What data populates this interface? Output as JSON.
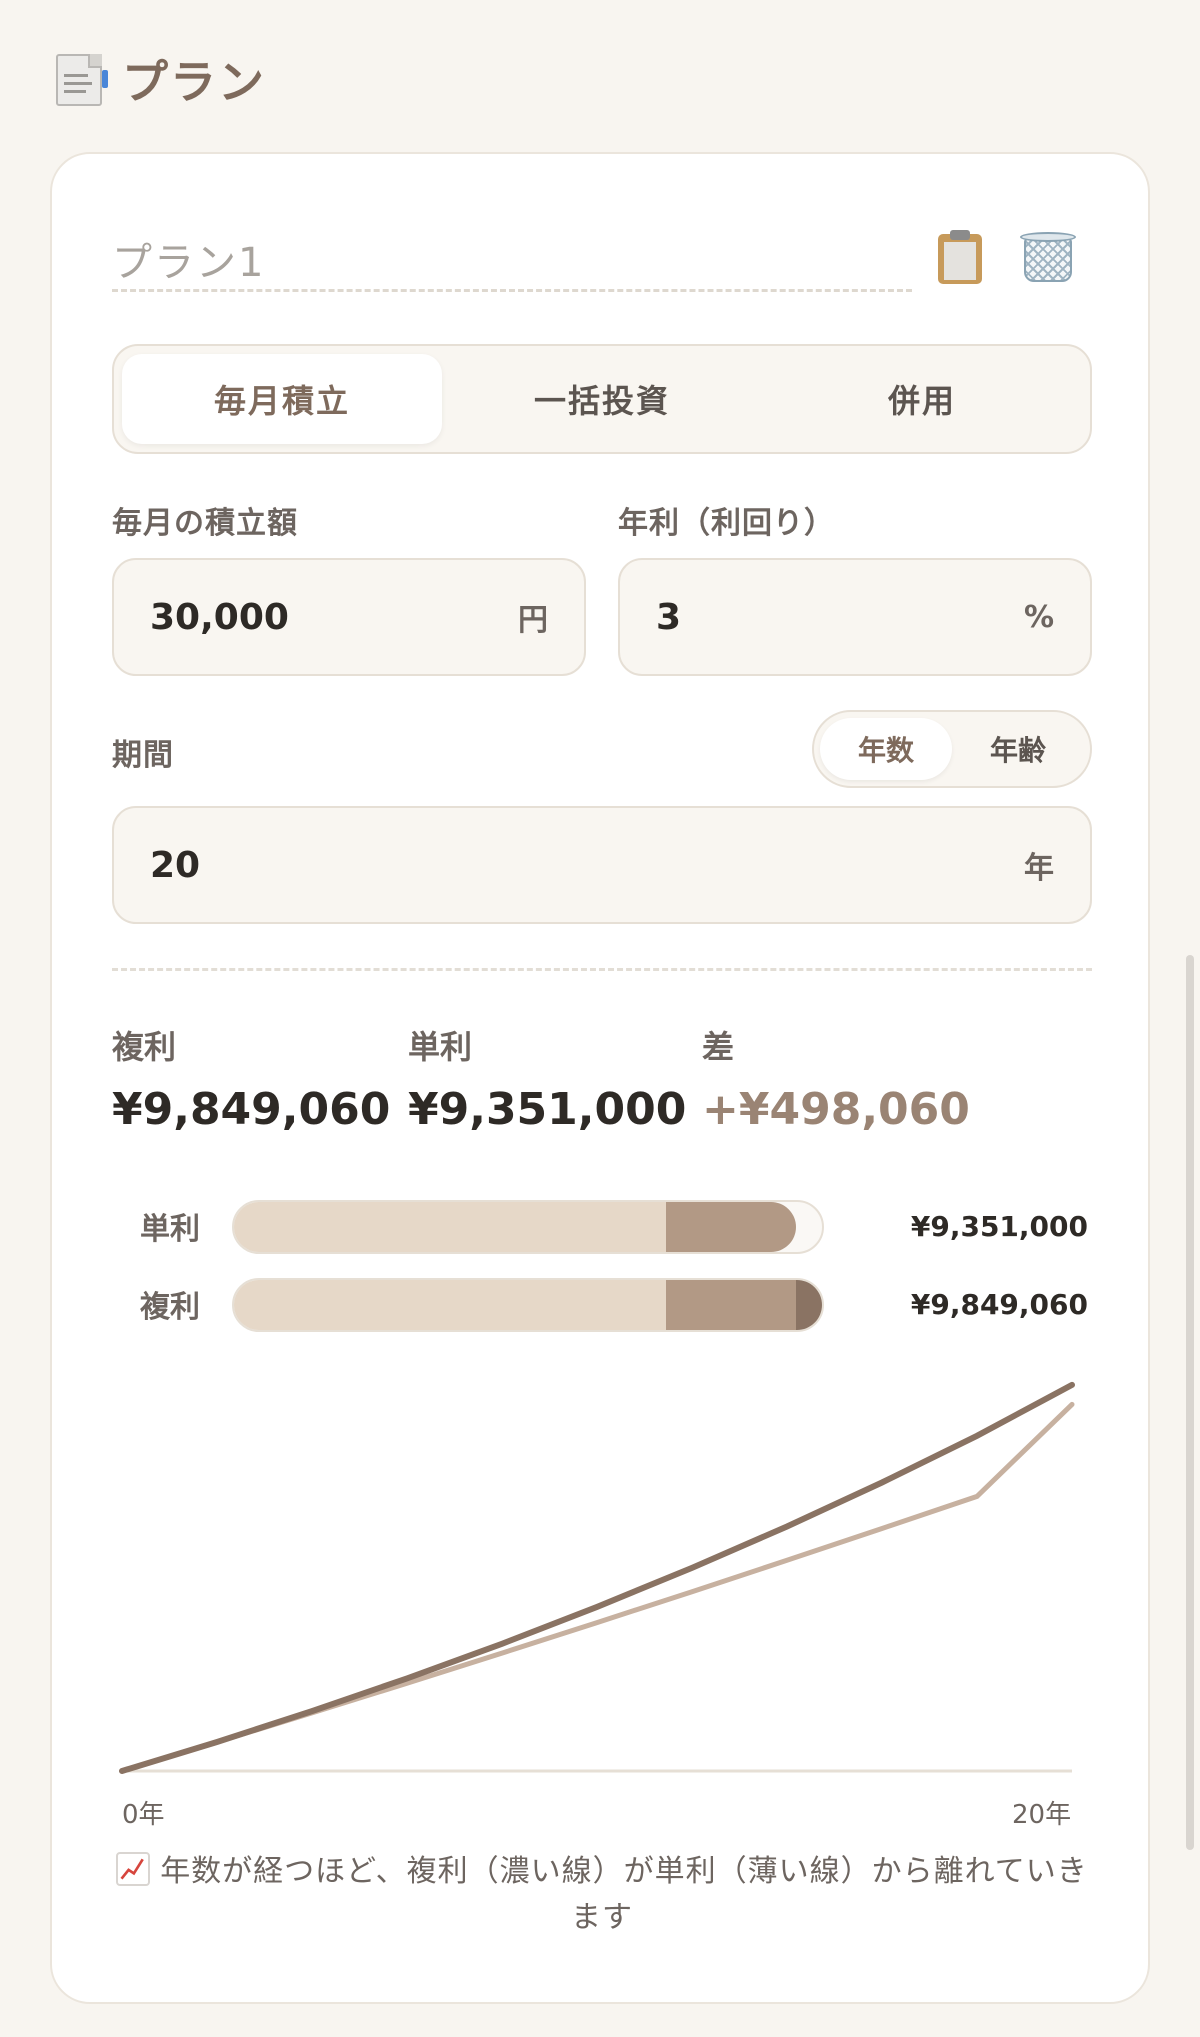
{
  "page": {
    "title": "プラン"
  },
  "plan": {
    "name": "プラン1",
    "modes": [
      "毎月積立",
      "一括投資",
      "併用"
    ],
    "active_mode": 0
  },
  "inputs": {
    "monthly": {
      "label": "毎月の積立額",
      "value": "30,000",
      "unit": "円"
    },
    "rate": {
      "label": "年利（利回り）",
      "value": "3",
      "unit": "%"
    },
    "period": {
      "label": "期間",
      "value": "20",
      "unit": "年",
      "toggle": [
        "年数",
        "年齢"
      ],
      "toggle_active": 0
    }
  },
  "results": {
    "compound": {
      "label": "複利",
      "value": "¥9,849,060"
    },
    "simple": {
      "label": "単利",
      "value": "¥9,351,000"
    },
    "diff": {
      "label": "差",
      "value": "+¥498,060"
    }
  },
  "bars": [
    {
      "label": "単利",
      "amount": "¥9,351,000",
      "principal_fraction": 0.73,
      "total_fraction": 0.95
    },
    {
      "label": "複利",
      "amount": "¥9,849,060",
      "principal_fraction": 0.73,
      "interest_fraction": 0.95,
      "total_fraction": 1.0
    }
  ],
  "chart_data": {
    "type": "line",
    "x": [
      0,
      2,
      4,
      6,
      8,
      10,
      12,
      14,
      16,
      18,
      20
    ],
    "series": [
      {
        "name": "複利",
        "values": [
          0,
          741000,
          1527000,
          2361000,
          3246000,
          4185000,
          5181000,
          6238000,
          7360000,
          8550000,
          9849060
        ]
      },
      {
        "name": "単利",
        "values": [
          0,
          736000,
          1483000,
          2239000,
          3007000,
          3785000,
          4574000,
          5374000,
          6185000,
          7006000,
          9351000
        ]
      }
    ],
    "xticks": [
      "0年",
      "20年"
    ],
    "colors": {
      "compound": "#8a7363",
      "simple": "#c7b1a0",
      "axis": "#e6dfd5"
    },
    "xlim": [
      0,
      20
    ],
    "ylim": [
      0,
      10000000
    ],
    "grid": false
  },
  "hint": "年数が経つほど、複利（濃い線）が単利（薄い線）から離れていきます",
  "colors": {
    "accent": "#7e6a5c",
    "diff": "#9a8474",
    "background": "#f8f5f0"
  },
  "icons": {
    "title": "page-icon",
    "copy": "clipboard-icon",
    "delete": "trash-icon",
    "hint": "chart-up-icon"
  }
}
